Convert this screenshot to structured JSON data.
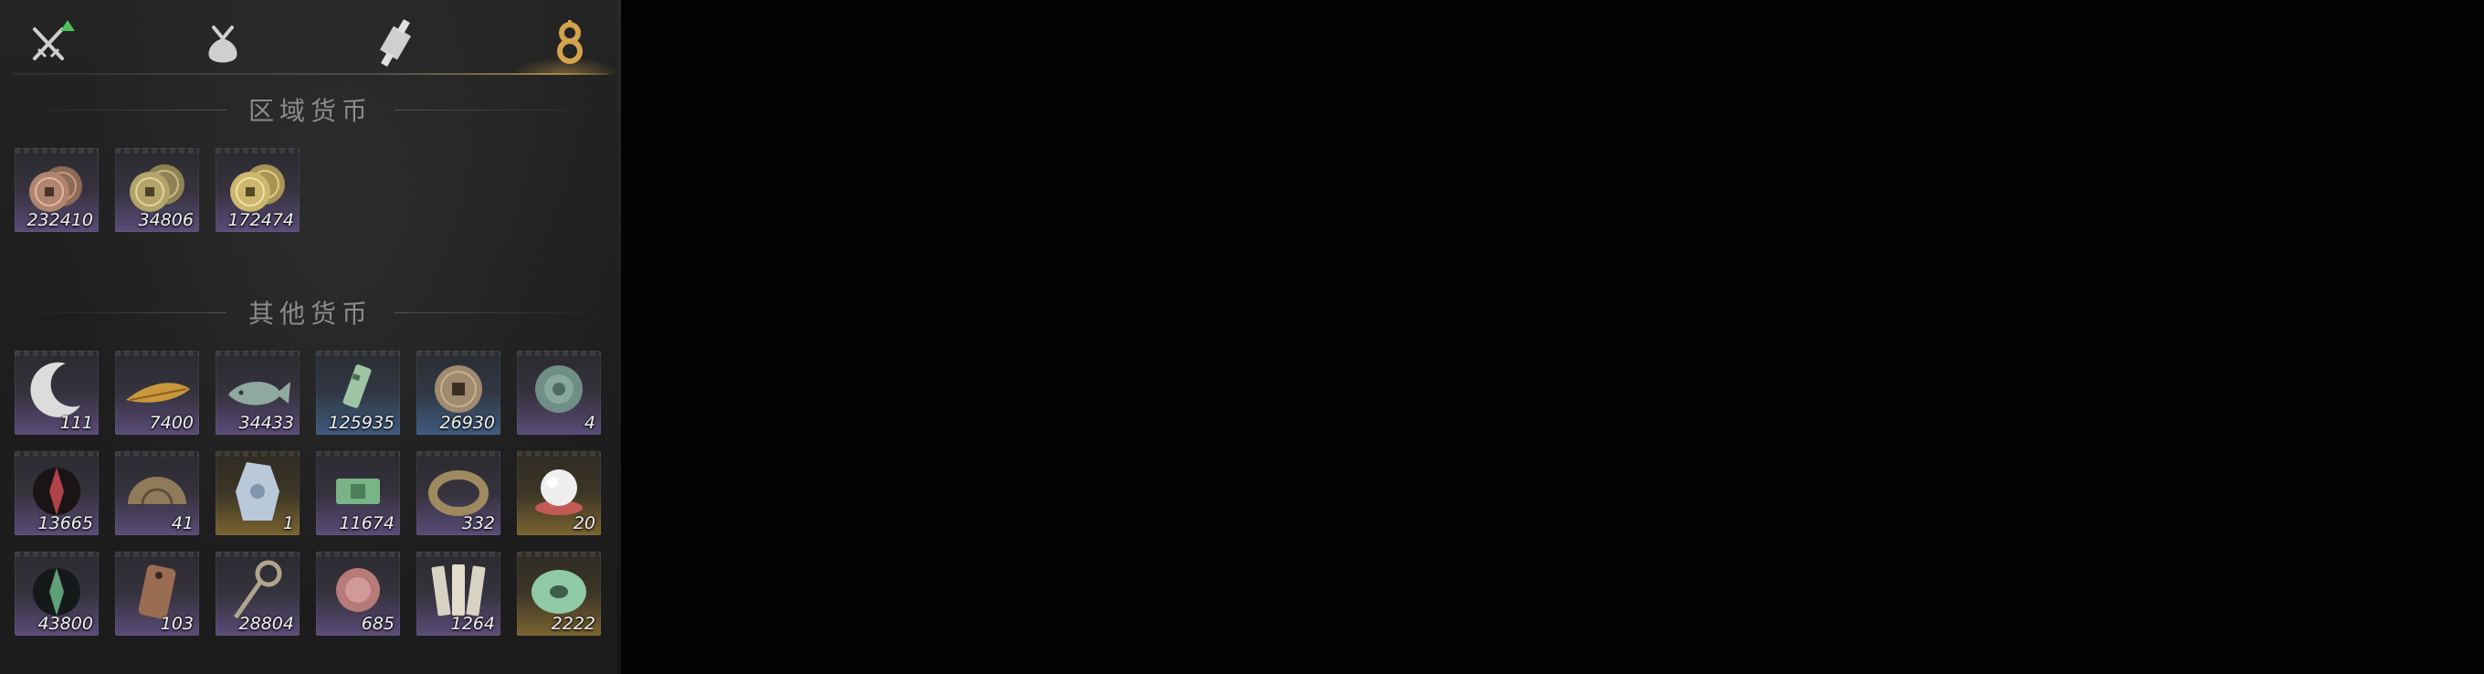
{
  "tabs": [
    {
      "id": "weapons",
      "icon": "crossed-swords-icon",
      "active": false,
      "badge": "upgrade-arrow"
    },
    {
      "id": "bag",
      "icon": "pouch-icon",
      "active": false
    },
    {
      "id": "scrolls",
      "icon": "scroll-icon",
      "active": false
    },
    {
      "id": "currency",
      "icon": "gourd-icon",
      "active": true,
      "accent": "#d4a24c"
    }
  ],
  "sections": {
    "regional": {
      "title": "区域货币"
    },
    "other": {
      "title": "其他货币"
    }
  },
  "regional_items": [
    {
      "icon": "copper-coins-icon",
      "count": "232410",
      "rarity": "purple"
    },
    {
      "icon": "brass-coins-icon",
      "count": "34806",
      "rarity": "purple"
    },
    {
      "icon": "gold-coins-icon",
      "count": "172474",
      "rarity": "purple"
    }
  ],
  "other_items": [
    {
      "icon": "crescent-moon-icon",
      "count": "111",
      "rarity": "purple"
    },
    {
      "icon": "golden-feather-icon",
      "count": "7400",
      "rarity": "purple"
    },
    {
      "icon": "jade-fish-icon",
      "count": "34433",
      "rarity": "purple"
    },
    {
      "icon": "jade-tablet-icon",
      "count": "125935",
      "rarity": "blue"
    },
    {
      "icon": "square-hole-coin-icon",
      "count": "26930",
      "rarity": "blue"
    },
    {
      "icon": "jade-medallion-icon",
      "count": "4",
      "rarity": "purple"
    },
    {
      "icon": "red-talisman-icon",
      "count": "13665",
      "rarity": "purple"
    },
    {
      "icon": "bronze-shell-icon",
      "count": "41",
      "rarity": "purple"
    },
    {
      "icon": "jade-stone-icon",
      "count": "1",
      "rarity": "gold"
    },
    {
      "icon": "green-bill-icon",
      "count": "11674",
      "rarity": "purple"
    },
    {
      "icon": "bronze-ring-icon",
      "count": "332",
      "rarity": "purple"
    },
    {
      "icon": "pearl-icon",
      "count": "20",
      "rarity": "gold"
    },
    {
      "icon": "green-talisman-icon",
      "count": "43800",
      "rarity": "purple"
    },
    {
      "icon": "copper-token-icon",
      "count": "103",
      "rarity": "purple"
    },
    {
      "icon": "coin-key-icon",
      "count": "28804",
      "rarity": "purple"
    },
    {
      "icon": "red-medallion-icon",
      "count": "685",
      "rarity": "purple"
    },
    {
      "icon": "bamboo-slips-icon",
      "count": "1264",
      "rarity": "purple"
    },
    {
      "icon": "jade-disc-icon",
      "count": "2222",
      "rarity": "gold"
    }
  ]
}
